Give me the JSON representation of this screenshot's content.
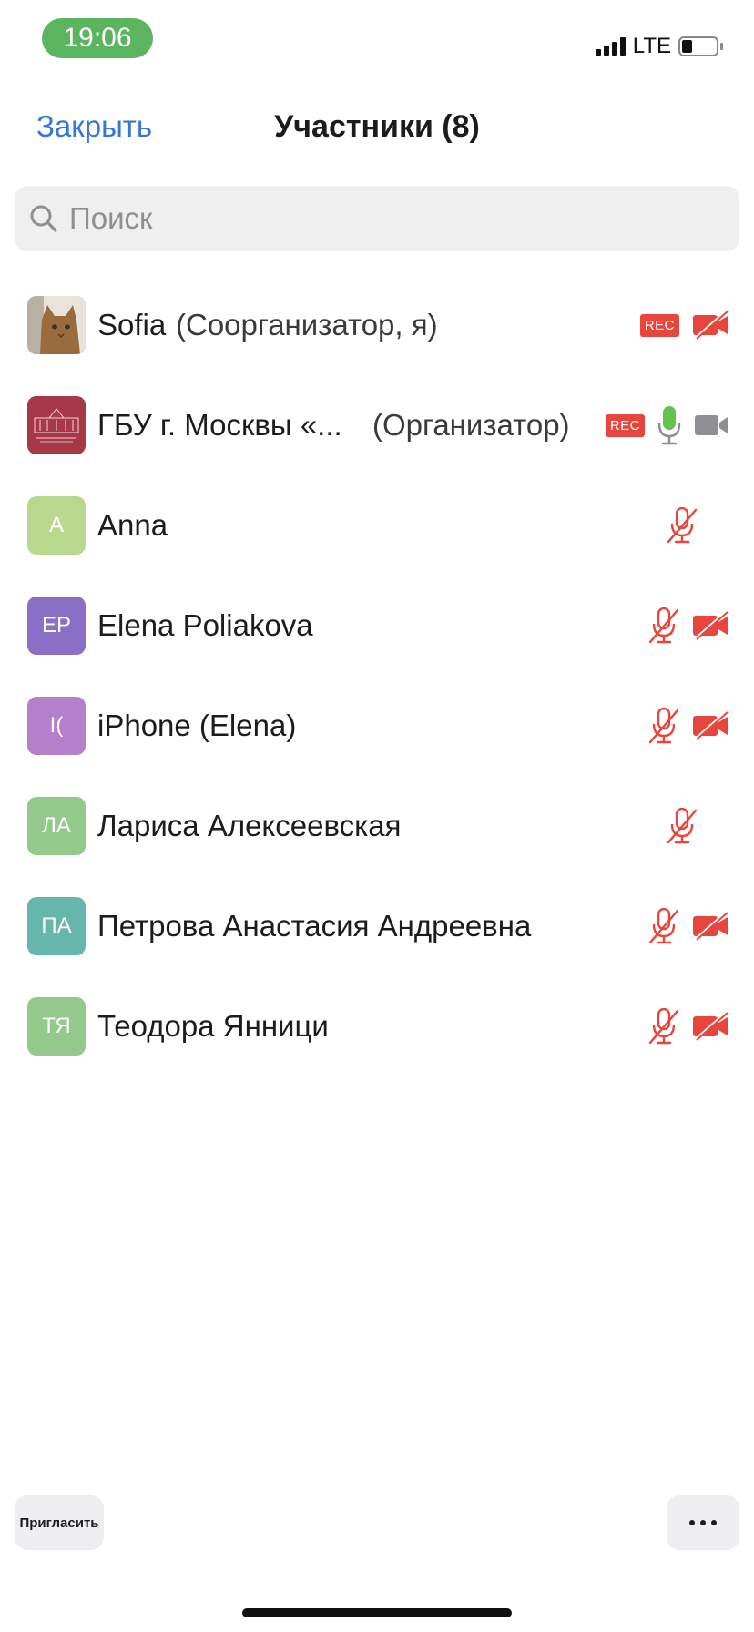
{
  "status_bar": {
    "time": "19:06",
    "network": "LTE",
    "signal_icon": "signal-bars-icon",
    "battery_icon": "battery-icon",
    "time_pill_color": "#5ab55e"
  },
  "nav": {
    "close_label": "Закрыть",
    "title": "Участники (8)",
    "accent_color": "#3478d6"
  },
  "search": {
    "placeholder": "Поиск",
    "value": "",
    "icon": "search-icon"
  },
  "participants": [
    {
      "name": "Sofia",
      "role": "(Соорганизатор, я)",
      "avatar_text": "",
      "avatar_kind": "photo-cat",
      "avatar_color": "#8a6a4a",
      "rec": true,
      "mic": "none",
      "video": "off"
    },
    {
      "name": "ГБУ г. Москвы «...",
      "role": "(Организатор)",
      "avatar_text": "",
      "avatar_kind": "photo-building",
      "avatar_color": "#a73847",
      "rec": true,
      "mic": "on",
      "video": "on"
    },
    {
      "name": "Anna",
      "role": "",
      "avatar_text": "A",
      "avatar_kind": "initials",
      "avatar_color": "#b9d88e",
      "rec": false,
      "mic": "muted",
      "video": "none"
    },
    {
      "name": "Elena Poliakova",
      "role": "",
      "avatar_text": "EP",
      "avatar_kind": "initials",
      "avatar_color": "#8b6fc7",
      "rec": false,
      "mic": "muted",
      "video": "off"
    },
    {
      "name": "iPhone (Elena)",
      "role": "",
      "avatar_text": "I(",
      "avatar_kind": "initials",
      "avatar_color": "#b67fcb",
      "rec": false,
      "mic": "muted",
      "video": "off"
    },
    {
      "name": "Лариса Алексеевская",
      "role": "",
      "avatar_text": "ЛА",
      "avatar_kind": "initials",
      "avatar_color": "#93c98a",
      "rec": false,
      "mic": "muted",
      "video": "none"
    },
    {
      "name": "Петрова Анастасия Андреевна",
      "role": "",
      "avatar_text": "ПА",
      "avatar_kind": "initials",
      "avatar_color": "#66b6ab",
      "rec": false,
      "mic": "muted",
      "video": "off"
    },
    {
      "name": "Теодора Янници",
      "role": "",
      "avatar_text": "ТЯ",
      "avatar_kind": "initials",
      "avatar_color": "#93c98a",
      "rec": false,
      "mic": "muted",
      "video": "off"
    }
  ],
  "rec_label": "REC",
  "footer": {
    "invite_label": "Пригласить",
    "more_icon": "more-icon"
  },
  "colors": {
    "muted_red": "#e8453c",
    "mic_on_green": "#62c24c",
    "video_on_gray": "#8e8e93"
  }
}
